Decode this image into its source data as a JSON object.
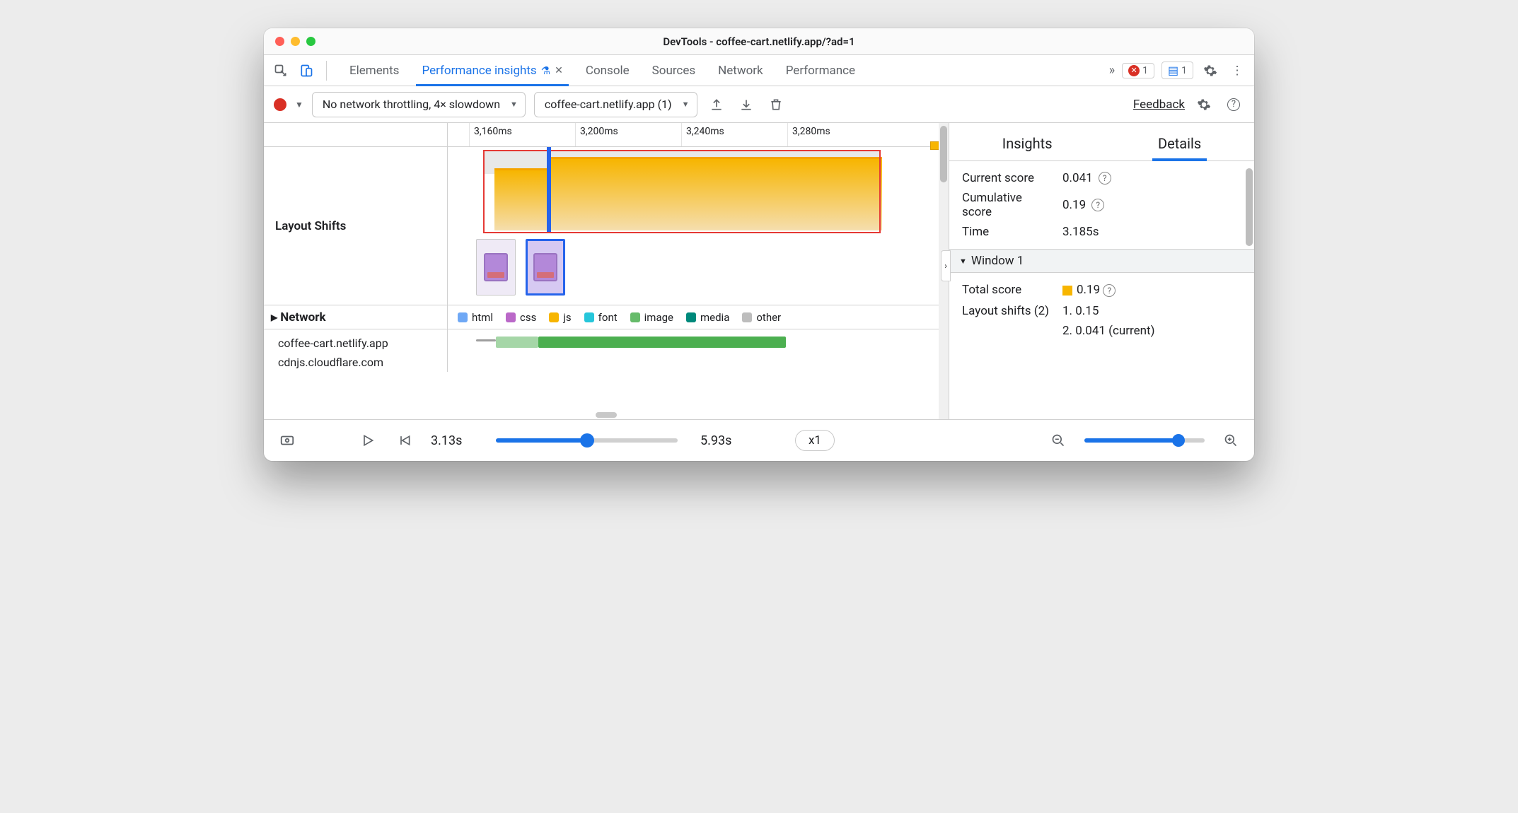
{
  "window": {
    "title": "DevTools - coffee-cart.netlify.app/?ad=1"
  },
  "tabs": {
    "items": [
      "Elements",
      "Performance insights",
      "Console",
      "Sources",
      "Network",
      "Performance"
    ],
    "active_index": 1,
    "errors_count": "1",
    "messages_count": "1"
  },
  "toolbar": {
    "throttling": "No network throttling, 4× slowdown",
    "recording": "coffee-cart.netlify.app (1)",
    "feedback": "Feedback"
  },
  "ruler": {
    "ticks": [
      "3,160ms",
      "3,200ms",
      "3,240ms",
      "3,280ms"
    ]
  },
  "layout_shifts": {
    "label": "Layout Shifts"
  },
  "network": {
    "label": "Network",
    "legend": [
      "html",
      "css",
      "js",
      "font",
      "image",
      "media",
      "other"
    ],
    "legend_colors": [
      "#6fa8f5",
      "#ba68c8",
      "#f7b500",
      "#26c6da",
      "#66bb6a",
      "#00897b",
      "#bdbdbd"
    ],
    "hosts": [
      "coffee-cart.netlify.app",
      "cdnjs.cloudflare.com"
    ]
  },
  "sidebar": {
    "tabs": [
      "Insights",
      "Details"
    ],
    "active_index": 1,
    "current_score_label": "Current score",
    "current_score": "0.041",
    "cumulative_score_label": "Cumulative score",
    "cumulative_score": "0.19",
    "time_label": "Time",
    "time_value": "3.185s",
    "window_header": "Window 1",
    "total_score_label": "Total score",
    "total_score": "0.19",
    "layout_shifts_label": "Layout shifts (2)",
    "ls_item1": "1. 0.15",
    "ls_item2": "2. 0.041 (current)"
  },
  "footer": {
    "time_start": "3.13s",
    "time_end": "5.93s",
    "speed": "x1",
    "play_pct": 50,
    "zoom_pct": 78
  }
}
